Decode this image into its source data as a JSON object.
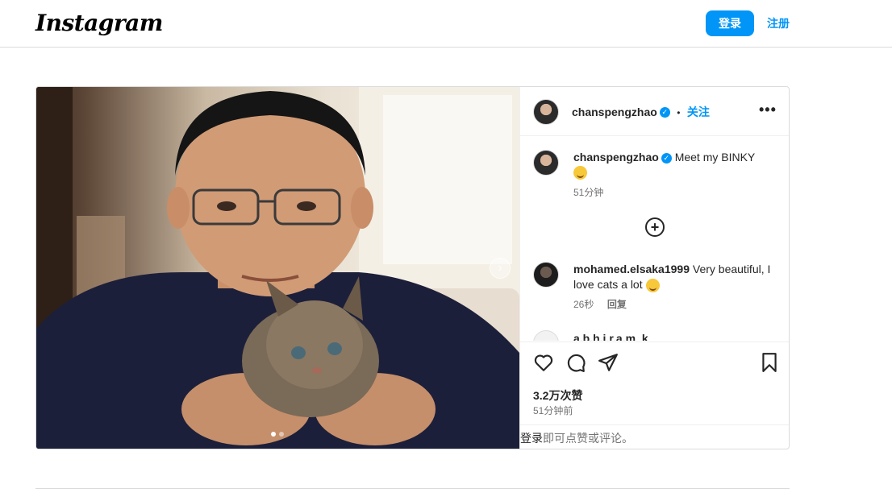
{
  "header": {
    "logo": "Instagram",
    "login_label": "登录",
    "signup_label": "注册"
  },
  "post": {
    "author": "chanspengzhao",
    "follow_label": "关注",
    "separator": "•",
    "more_icon": "more-horizontal-icon",
    "caption": "Meet my BINKY",
    "caption_time": "51分钟",
    "comments": [
      {
        "user": "mohamed.elsaka1999",
        "text": "Very beautiful, I love cats a lot",
        "time": "26秒",
        "reply_label": "回复"
      },
      {
        "user": "a.b.h.i.r.a.m_k",
        "text": ""
      }
    ],
    "likes": "3.2万次赞",
    "posted_time": "51分钟前",
    "login_prompt_link": "登录",
    "login_prompt_text": "即可点赞或评论。",
    "carousel_count": 2,
    "carousel_index": 1
  },
  "colors": {
    "accent": "#0095f6",
    "text": "#262626",
    "muted": "#737373",
    "border": "#dbdbdb"
  }
}
